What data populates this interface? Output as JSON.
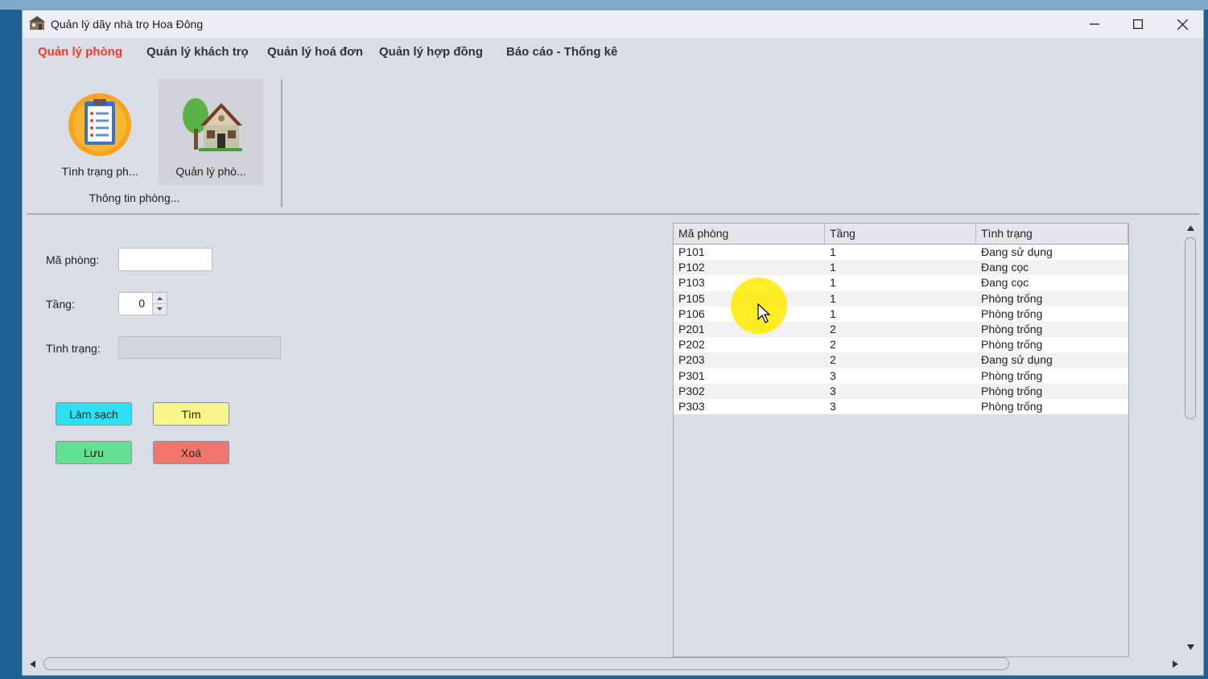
{
  "window": {
    "title": "Quản lý dãy nhà trọ Hoa Đông"
  },
  "menu": [
    {
      "label": "Quản lý phòng",
      "active": true
    },
    {
      "label": "Quản lý khách trọ",
      "active": false
    },
    {
      "label": "Quản lý hoá đơn",
      "active": false
    },
    {
      "label": "Quản lý hợp đồng",
      "active": false
    },
    {
      "label": "Báo cáo - Thống kê",
      "active": false
    }
  ],
  "ribbon": {
    "buttons": [
      {
        "label": "Tình trạng ph...",
        "icon": "clipboard-icon"
      },
      {
        "label": "Quản lý phò...",
        "icon": "house-tree-icon"
      }
    ],
    "group_label": "Thông tin phòng..."
  },
  "form": {
    "ma_phong_label": "Mã phòng:",
    "ma_phong_value": "",
    "tang_label": "Tầng:",
    "tang_value": "0",
    "tinh_trang_label": "Tình trạng:",
    "tinh_trang_value": ""
  },
  "buttons": {
    "lam_sach": "Làm sạch",
    "tim": "Tìm",
    "luu": "Lưu",
    "xoa": "Xoá"
  },
  "table": {
    "columns": [
      "Mã phòng",
      "Tầng",
      "Tình trạng"
    ],
    "rows": [
      [
        "P101",
        "1",
        "Đang sử dụng"
      ],
      [
        "P102",
        "1",
        "Đang cọc"
      ],
      [
        "P103",
        "1",
        "Đang cọc"
      ],
      [
        "P105",
        "1",
        "Phòng trống"
      ],
      [
        "P106",
        "1",
        "Phòng trống"
      ],
      [
        "P201",
        "2",
        "Phòng trống"
      ],
      [
        "P202",
        "2",
        "Phòng trống"
      ],
      [
        "P203",
        "2",
        "Đang sử dụng"
      ],
      [
        "P301",
        "3",
        "Phòng trống"
      ],
      [
        "P302",
        "3",
        "Phòng trống"
      ],
      [
        "P303",
        "3",
        "Phòng trống"
      ]
    ]
  },
  "colors": {
    "active_menu": "#ee3b2b",
    "btn_lam_sach": "#2ee0f4",
    "btn_tim": "#f5f58a",
    "btn_luu": "#63e092",
    "btn_xoa": "#f3766c"
  }
}
